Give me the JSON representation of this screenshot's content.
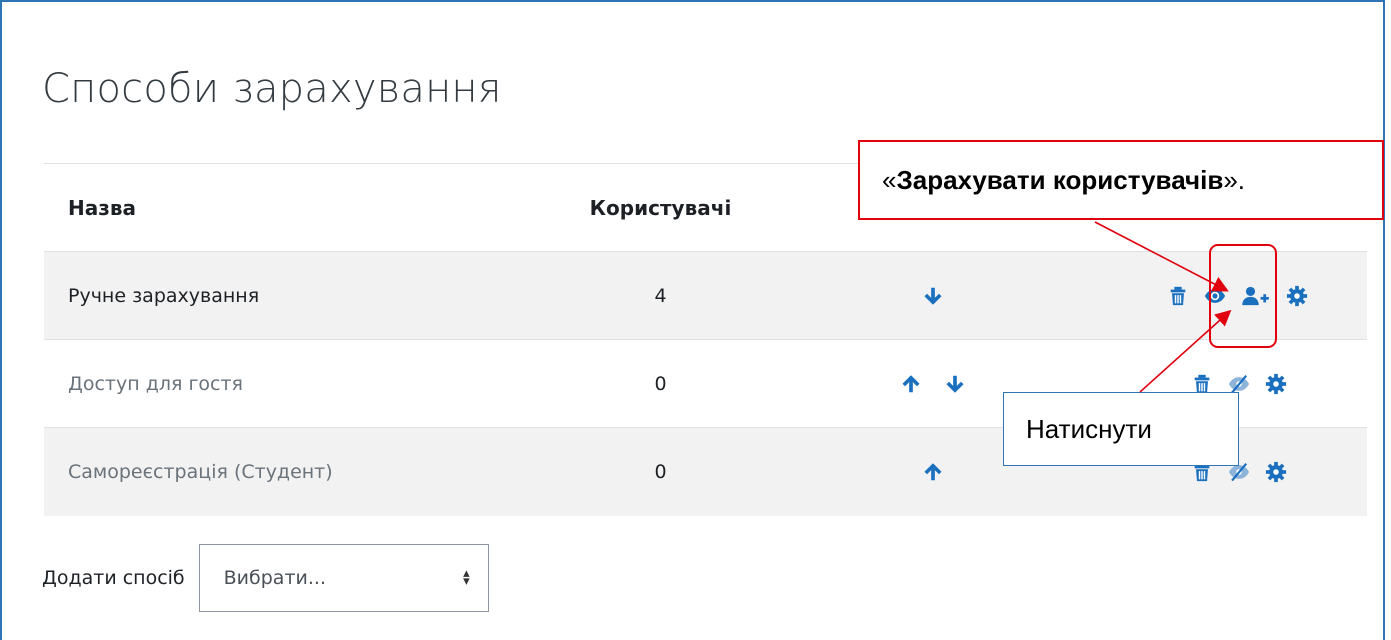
{
  "page": {
    "title": "Способи зарахування"
  },
  "table": {
    "headers": {
      "name": "Назва",
      "users": "Користувачі"
    },
    "rows": [
      {
        "name": "Ручне зарахування",
        "users": "4",
        "state": "enabled",
        "order": [
          "down-arrow-icon"
        ],
        "edit": [
          "trash-icon",
          "eye-icon",
          "enrol-users-icon",
          "gear-icon"
        ]
      },
      {
        "name": "Доступ для гостя",
        "users": "0",
        "state": "disabled",
        "order": [
          "up-arrow-icon",
          "down-arrow-icon"
        ],
        "edit": [
          "trash-icon",
          "eye-slash-icon",
          "gear-icon"
        ]
      },
      {
        "name": "Самореєстрація (Студент)",
        "users": "0",
        "state": "disabled",
        "order": [
          "up-arrow-icon"
        ],
        "edit": [
          "trash-icon",
          "eye-slash-icon",
          "gear-icon"
        ]
      }
    ]
  },
  "add_method": {
    "label": "Додати спосіб",
    "select_value": "Вибрати..."
  },
  "annotations": {
    "top_callout_open": "«",
    "top_callout_bold": "Зарахувати користувачів",
    "top_callout_close": "».",
    "bottom_callout": "Натиснути"
  },
  "colors": {
    "icon": "#1a6fbf",
    "callout_border": "#e0000e",
    "frame_border": "#2e75b6",
    "odd_row": "#f2f2f2"
  }
}
